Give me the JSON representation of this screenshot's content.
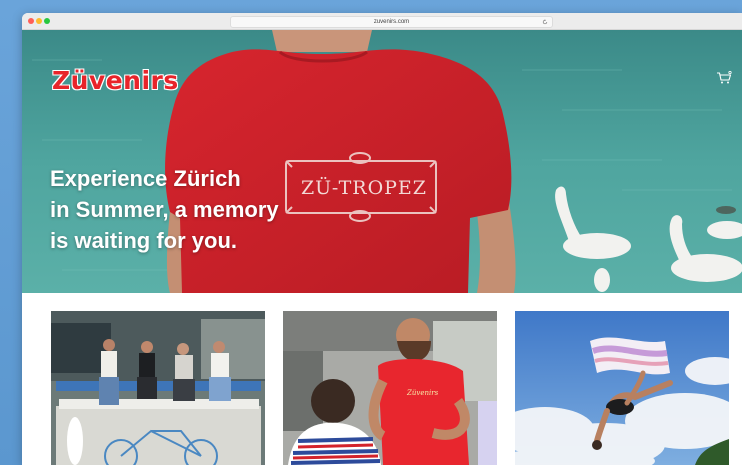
{
  "browser": {
    "url": "zuvenirs.com"
  },
  "site": {
    "logo_text": "Züvenirs",
    "brand_color": "#e8242a"
  },
  "hero": {
    "headline_line1": "Experience Zürich",
    "headline_line2": "in Summer, a memory",
    "headline_line3": "is waiting for you.",
    "shirt_print": "ZÜ-TROPEZ"
  },
  "cards": {
    "card2_shirt_print": "Züvenirs"
  },
  "icons": {
    "cart": "cart-icon",
    "reload": "reload-icon"
  }
}
